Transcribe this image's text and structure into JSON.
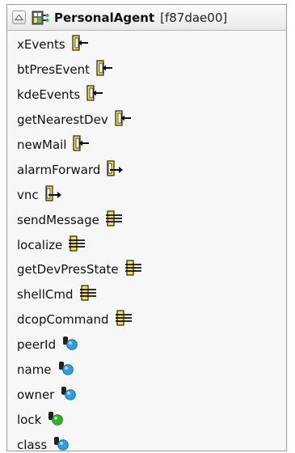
{
  "agent": {
    "name": "PersonalAgent",
    "id": "[f87dae00]"
  },
  "members": [
    {
      "label": "xEvents",
      "kind": "event-in",
      "icon": "event-inbound-icon"
    },
    {
      "label": "btPresEvent",
      "kind": "event-in",
      "icon": "event-inbound-icon"
    },
    {
      "label": "kdeEvents",
      "kind": "event-in",
      "icon": "event-inbound-icon"
    },
    {
      "label": "getNearestDev",
      "kind": "event-in",
      "icon": "event-inbound-icon"
    },
    {
      "label": "newMail",
      "kind": "event-in",
      "icon": "event-inbound-icon"
    },
    {
      "label": "alarmForward",
      "kind": "event-out",
      "icon": "event-outbound-icon"
    },
    {
      "label": "vnc",
      "kind": "event-out",
      "icon": "event-outbound-icon"
    },
    {
      "label": "sendMessage",
      "kind": "method",
      "icon": "method-port-icon"
    },
    {
      "label": "localize",
      "kind": "method",
      "icon": "method-port-icon"
    },
    {
      "label": "getDevPresState",
      "kind": "method",
      "icon": "method-port-icon"
    },
    {
      "label": "shellCmd",
      "kind": "method",
      "icon": "method-port-icon"
    },
    {
      "label": "dcopCommand",
      "kind": "method",
      "icon": "method-port-icon"
    },
    {
      "label": "peerId",
      "kind": "attr",
      "icon": "attribute-blue-icon"
    },
    {
      "label": "name",
      "kind": "attr",
      "icon": "attribute-blue-icon"
    },
    {
      "label": "owner",
      "kind": "attr",
      "icon": "attribute-blue-icon"
    },
    {
      "label": "lock",
      "kind": "attr-green",
      "icon": "attribute-green-icon"
    },
    {
      "label": "class",
      "kind": "attr",
      "icon": "attribute-blue-icon"
    }
  ],
  "colors": {
    "attribute_blue": "#2f9de0",
    "attribute_green": "#2bb52b",
    "port_yellow": "#f4e33a"
  }
}
